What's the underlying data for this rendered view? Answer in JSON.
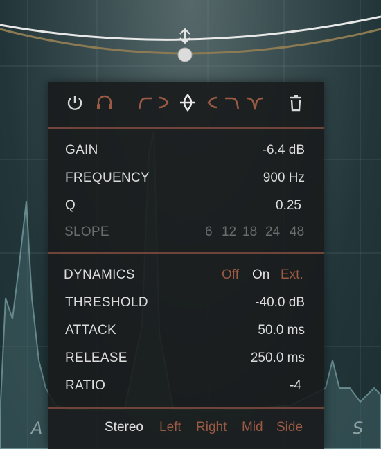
{
  "toolbar": {
    "icons": [
      "power-icon",
      "headphones-icon",
      "low-cut-icon",
      "low-shelf-icon",
      "bell-icon",
      "high-shelf-icon",
      "high-cut-icon",
      "notch-icon",
      "trash-icon"
    ]
  },
  "params": {
    "gain": {
      "label": "GAIN",
      "value": "-6.4 dB"
    },
    "frequency": {
      "label": "FREQUENCY",
      "value": "900 Hz"
    },
    "q": {
      "label": "Q",
      "value": "0.25"
    },
    "slope": {
      "label": "SLOPE",
      "options": [
        "6",
        "12",
        "18",
        "24",
        "48"
      ]
    }
  },
  "dynamics": {
    "label": "DYNAMICS",
    "options": [
      "Off",
      "On",
      "Ext."
    ],
    "threshold": {
      "label": "THRESHOLD",
      "value": "-40.0 dB"
    },
    "attack": {
      "label": "ATTACK",
      "value": "50.0 ms"
    },
    "release": {
      "label": "RELEASE",
      "value": "250.0 ms"
    },
    "ratio": {
      "label": "RATIO",
      "value": "-4"
    }
  },
  "stereo": {
    "options": [
      "Stereo",
      "Left",
      "Right",
      "Mid",
      "Side"
    ]
  },
  "corner_labels": {
    "left": "A",
    "right": "S"
  },
  "colors": {
    "accent": "#9a5a44",
    "active_text": "#e2e2e2",
    "dim_text": "#6c6c6c",
    "curve": "#e8e8e8",
    "curve_secondary": "#8c7a52"
  }
}
